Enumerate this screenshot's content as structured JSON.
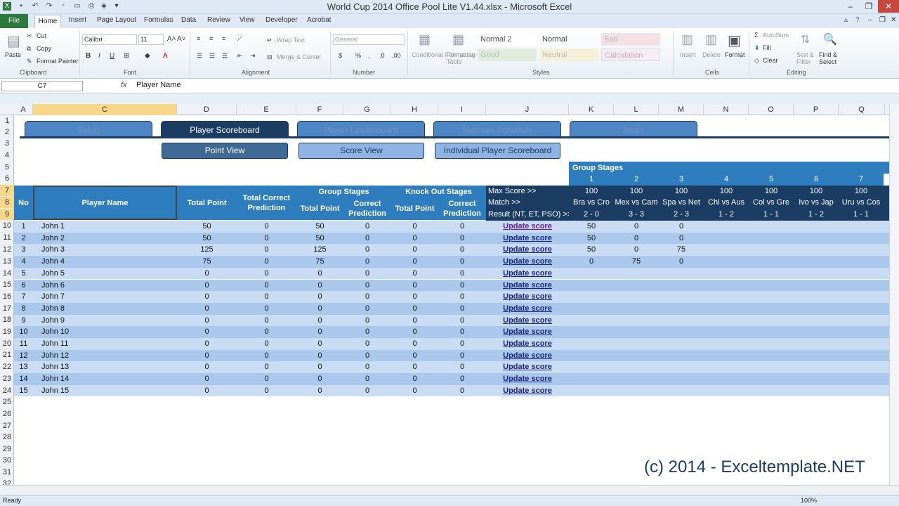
{
  "window": {
    "title": "World Cup 2014 Office Pool Lite V1.44.xlsx  -  Microsoft Excel"
  },
  "ribbon": {
    "file_tab": "File",
    "tabs": [
      "Home",
      "Insert",
      "Page Layout",
      "Formulas",
      "Data",
      "Review",
      "View",
      "Developer",
      "Acrobat"
    ],
    "clipboard": {
      "paste": "Paste",
      "cut": "Cut",
      "copy": "Copy",
      "format_painter": "Format Painter",
      "label": "Clipboard"
    },
    "font": {
      "name": "Calibri",
      "size": "11",
      "label": "Font"
    },
    "alignment": {
      "wrap": "Wrap Text",
      "merge": "Merge & Center",
      "label": "Alignment"
    },
    "number": {
      "format": "General",
      "label": "Number"
    },
    "styles": {
      "cond": "Conditional Formatting",
      "fmt_table": "Format as Table",
      "normal2": "Normal 2",
      "normal": "Normal",
      "bad": "Bad",
      "good": "Good",
      "neutral": "Neutral",
      "calculation": "Calculation",
      "label": "Styles"
    },
    "cells": {
      "insert": "Insert",
      "delete": "Delete",
      "format": "Format",
      "label": "Cells"
    },
    "editing": {
      "autosum": "AutoSum",
      "fill": "Fill",
      "clear": "Clear",
      "sort": "Sort & Filter",
      "find": "Find & Select",
      "label": "Editing"
    }
  },
  "formula": {
    "namebox": "C7",
    "fx": "fx",
    "value": "Player Name"
  },
  "columns": [
    "A",
    "C",
    "D",
    "E",
    "F",
    "G",
    "H",
    "I",
    "J",
    "K",
    "L",
    "M",
    "N",
    "O",
    "P",
    "Q"
  ],
  "rows": [
    "1",
    "2",
    "3",
    "4",
    "5",
    "6",
    "7",
    "8",
    "9",
    "10",
    "11",
    "12",
    "13",
    "14",
    "15",
    "16",
    "17",
    "18",
    "19",
    "20",
    "21",
    "22",
    "23",
    "24",
    "25",
    "26",
    "27",
    "28",
    "29",
    "30",
    "31",
    "32"
  ],
  "nav": [
    "Setup",
    "Player Scoreboard",
    "Player Leaderboard",
    "Matches Schedule",
    "About"
  ],
  "views": [
    "Point View",
    "Score View",
    "Individual Player Scoreboard"
  ],
  "headers": {
    "no": "No",
    "player": "Player Name",
    "total_point": "Total Point",
    "total_correct": "Total Correct Prediction",
    "group_stages": "Group Stages",
    "knockout": "Knock Out Stages",
    "gs_total": "Total Point",
    "gs_correct": "Correct Prediction",
    "ko_total": "Total Point",
    "ko_correct": "Correct Prediction"
  },
  "match_labels": {
    "max_score": "Max Score >>",
    "match": "Match >>",
    "result": "Result (NT, ET, PSO) >>"
  },
  "group_stages_title": "Group Stages",
  "matches": [
    {
      "num": "1",
      "max": "100",
      "match": "Bra vs Cro",
      "result": "2 - 0"
    },
    {
      "num": "2",
      "max": "100",
      "match": "Mex vs Cam",
      "result": "3 - 3"
    },
    {
      "num": "3",
      "max": "100",
      "match": "Spa vs Net",
      "result": "2 - 3"
    },
    {
      "num": "4",
      "max": "100",
      "match": "Chi vs Aus",
      "result": "1 - 2"
    },
    {
      "num": "5",
      "max": "100",
      "match": "Col vs Gre",
      "result": "1 - 1"
    },
    {
      "num": "6",
      "max": "100",
      "match": "Ivo vs Jap",
      "result": "1 - 2"
    },
    {
      "num": "7",
      "max": "100",
      "match": "Uru vs Cos",
      "result": "1 - 1"
    }
  ],
  "update_label": "Update score",
  "players": [
    {
      "no": "1",
      "name": "John 1",
      "tp": "50",
      "tc": "0",
      "gt": "50",
      "gc": "0",
      "kt": "0",
      "kc": "0",
      "m": [
        "50",
        "0",
        "0"
      ]
    },
    {
      "no": "2",
      "name": "John 2",
      "tp": "50",
      "tc": "0",
      "gt": "50",
      "gc": "0",
      "kt": "0",
      "kc": "0",
      "m": [
        "50",
        "0",
        "0"
      ]
    },
    {
      "no": "3",
      "name": "John 3",
      "tp": "125",
      "tc": "0",
      "gt": "125",
      "gc": "0",
      "kt": "0",
      "kc": "0",
      "m": [
        "50",
        "0",
        "75"
      ]
    },
    {
      "no": "4",
      "name": "John 4",
      "tp": "75",
      "tc": "0",
      "gt": "75",
      "gc": "0",
      "kt": "0",
      "kc": "0",
      "m": [
        "0",
        "75",
        "0"
      ]
    },
    {
      "no": "5",
      "name": "John 5",
      "tp": "0",
      "tc": "0",
      "gt": "0",
      "gc": "0",
      "kt": "0",
      "kc": "0",
      "m": []
    },
    {
      "no": "6",
      "name": "John 6",
      "tp": "0",
      "tc": "0",
      "gt": "0",
      "gc": "0",
      "kt": "0",
      "kc": "0",
      "m": []
    },
    {
      "no": "7",
      "name": "John 7",
      "tp": "0",
      "tc": "0",
      "gt": "0",
      "gc": "0",
      "kt": "0",
      "kc": "0",
      "m": []
    },
    {
      "no": "8",
      "name": "John 8",
      "tp": "0",
      "tc": "0",
      "gt": "0",
      "gc": "0",
      "kt": "0",
      "kc": "0",
      "m": []
    },
    {
      "no": "9",
      "name": "John 9",
      "tp": "0",
      "tc": "0",
      "gt": "0",
      "gc": "0",
      "kt": "0",
      "kc": "0",
      "m": []
    },
    {
      "no": "10",
      "name": "John 10",
      "tp": "0",
      "tc": "0",
      "gt": "0",
      "gc": "0",
      "kt": "0",
      "kc": "0",
      "m": []
    },
    {
      "no": "11",
      "name": "John 11",
      "tp": "0",
      "tc": "0",
      "gt": "0",
      "gc": "0",
      "kt": "0",
      "kc": "0",
      "m": []
    },
    {
      "no": "12",
      "name": "John 12",
      "tp": "0",
      "tc": "0",
      "gt": "0",
      "gc": "0",
      "kt": "0",
      "kc": "0",
      "m": []
    },
    {
      "no": "13",
      "name": "John 13",
      "tp": "0",
      "tc": "0",
      "gt": "0",
      "gc": "0",
      "kt": "0",
      "kc": "0",
      "m": []
    },
    {
      "no": "14",
      "name": "John 14",
      "tp": "0",
      "tc": "0",
      "gt": "0",
      "gc": "0",
      "kt": "0",
      "kc": "0",
      "m": []
    },
    {
      "no": "15",
      "name": "John 15",
      "tp": "0",
      "tc": "0",
      "gt": "0",
      "gc": "0",
      "kt": "0",
      "kc": "0",
      "m": []
    }
  ],
  "copyright": "(c) 2014 - Exceltemplate.NET",
  "status": {
    "ready": "Ready",
    "zoom": "100%"
  },
  "colors": {
    "accent_dark": "#1b3d63",
    "header_blue": "#2e7ebf",
    "row_light": "#c9dcf3",
    "row_mid": "#a9c8ec"
  }
}
